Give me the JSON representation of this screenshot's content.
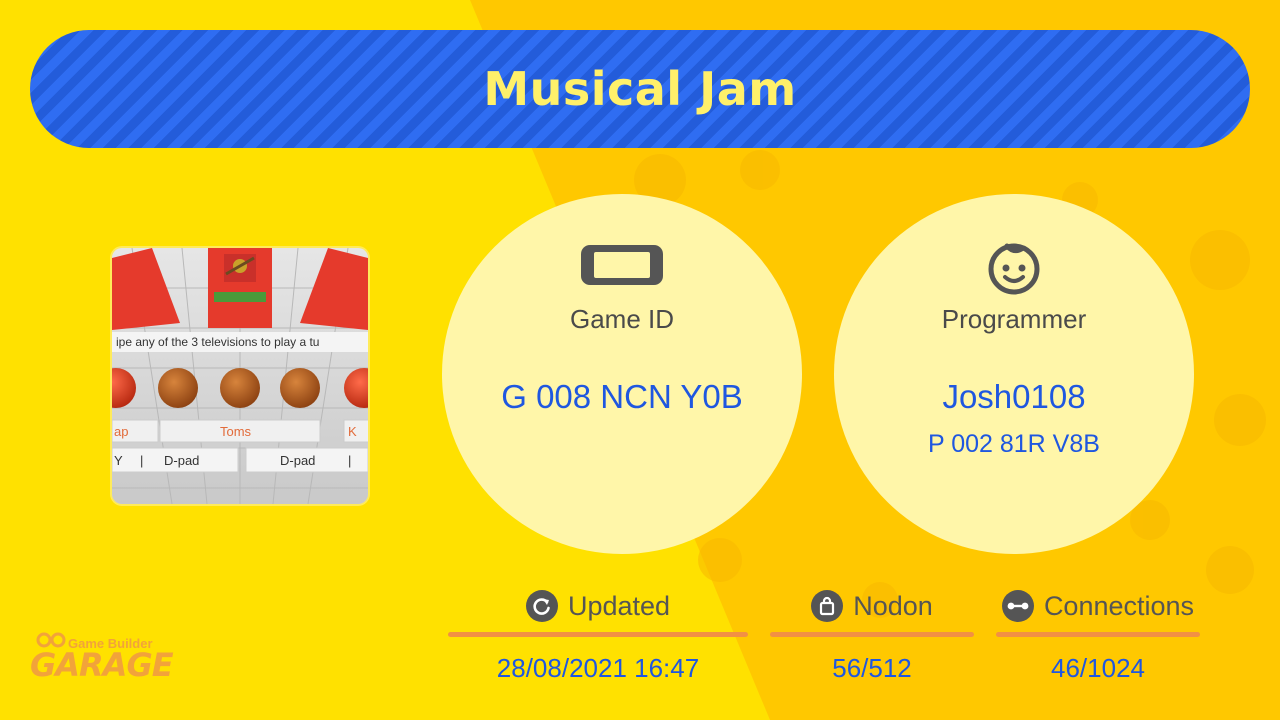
{
  "title": "Musical Jam",
  "thumbnail": {
    "instruction_text": "ipe any of the 3 televisions to play a tu",
    "pad_labels": [
      "ap",
      "Toms",
      "K"
    ],
    "control_labels": [
      "Y",
      "|",
      "D-pad",
      "D-pad",
      "|"
    ]
  },
  "game_id": {
    "icon": "switch-console-icon",
    "label": "Game ID",
    "value": "G 008 NCN Y0B"
  },
  "programmer": {
    "icon": "face-icon",
    "label": "Programmer",
    "name": "Josh0108",
    "id": "P 002 81R V8B"
  },
  "stats": {
    "updated": {
      "icon": "refresh-icon",
      "label": "Updated",
      "value": "28/08/2021 16:47"
    },
    "nodon": {
      "icon": "bag-icon",
      "label": "Nodon",
      "value": "56/512"
    },
    "connections": {
      "icon": "connection-icon",
      "label": "Connections",
      "value": "46/1024"
    }
  },
  "brand": {
    "small": "Game Builder",
    "big": "GARAGE"
  },
  "colors": {
    "background_left": "#FFE100",
    "background_right": "#FFC800",
    "banner_blue": "#2F6DF2",
    "title_yellow": "#FFF06A",
    "value_blue": "#1F57E0",
    "accent_orange": "#F29043"
  }
}
